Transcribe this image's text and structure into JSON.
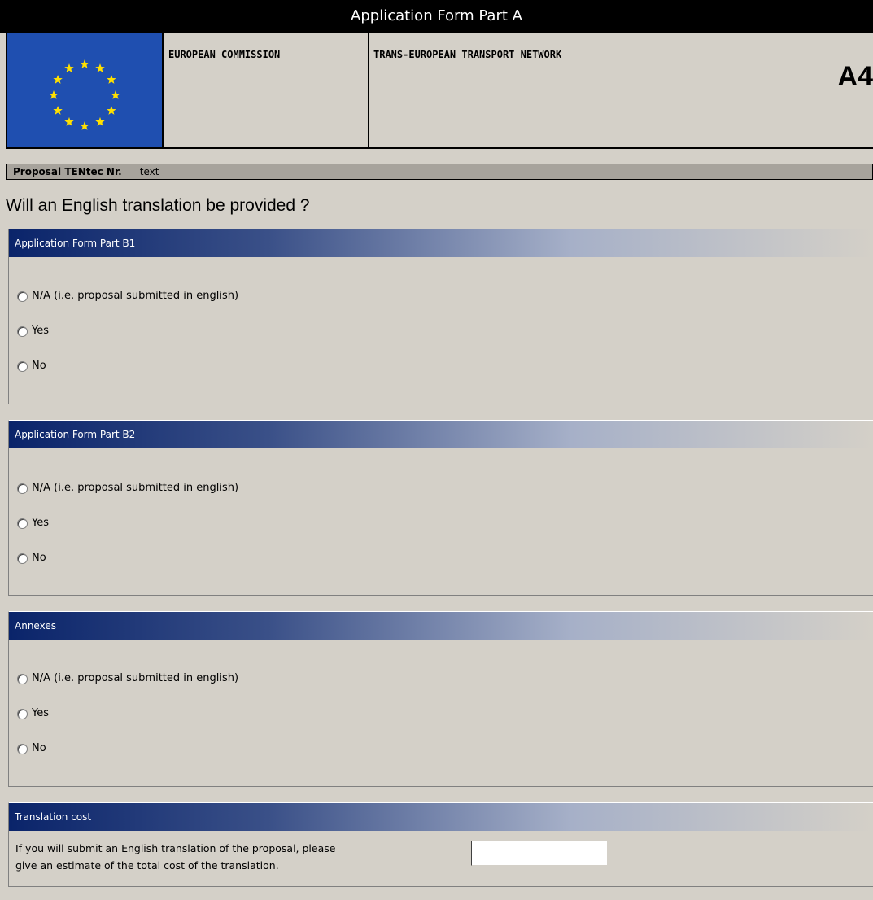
{
  "window": {
    "title": "Application Form Part A"
  },
  "header": {
    "logo_icon": "eu-flag-icon",
    "org": "EUROPEAN COMMISSION",
    "network": "TRANS-EUROPEAN TRANSPORT NETWORK",
    "form_code": "A4"
  },
  "proposal": {
    "label": "Proposal TENtec Nr.",
    "value": "text"
  },
  "question": "Will an English translation be provided ?",
  "sections": [
    {
      "title": "Application Form Part B1",
      "options": [
        "N/A (i.e. proposal submitted in english)",
        "Yes",
        "No"
      ]
    },
    {
      "title": "Application Form Part B2",
      "options": [
        "N/A (i.e. proposal submitted in english)",
        "Yes",
        "No"
      ]
    },
    {
      "title": "Annexes",
      "options": [
        "N/A (i.e. proposal submitted in english)",
        "Yes",
        "No"
      ]
    }
  ],
  "cost": {
    "title": "Translation cost",
    "text_line1": "If you will submit an English translation of the proposal, please",
    "text_line2": "give an estimate of the total cost of the translation.",
    "value": ""
  },
  "colors": {
    "panel_header_start": "#0a246a",
    "background": "#d4d0c8",
    "flag_blue": "#1f4fb0",
    "flag_star": "#ffe000"
  }
}
